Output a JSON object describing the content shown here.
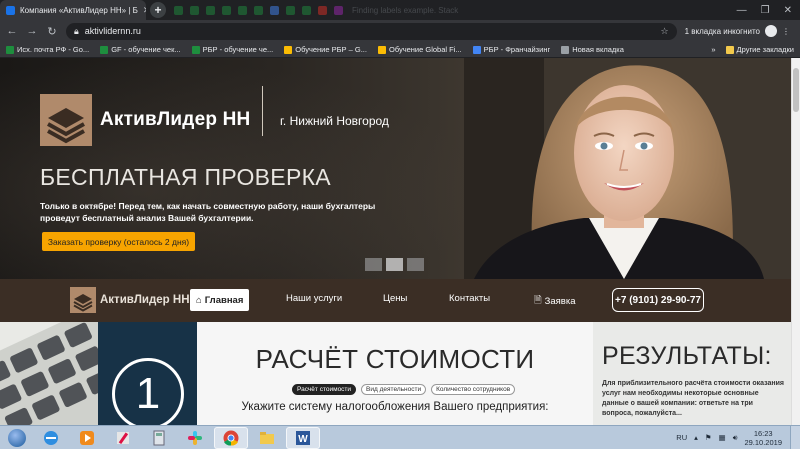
{
  "browser": {
    "active_tab_title": "Компания «АктивЛидер НН» | Б",
    "faded_tab_title": "Finding labels example. Stack",
    "url": "aktivlidernn.ru",
    "incognito_label": "1 вкладка инкогнито",
    "bookmarks": [
      {
        "label": "Исх. почта РФ - Go...",
        "color": "#1e8e3e"
      },
      {
        "label": "GF - обучение чек...",
        "color": "#1e8e3e"
      },
      {
        "label": "РБР - обучение че...",
        "color": "#1e8e3e"
      },
      {
        "label": "Обучение РБР – G...",
        "color": "#fbbc04"
      },
      {
        "label": "Обучение Global Fi...",
        "color": "#fbbc04"
      },
      {
        "label": "РБР - Франчайзинг",
        "color": "#4285f4"
      },
      {
        "label": "Новая вкладка",
        "color": "#9aa0a6"
      }
    ],
    "other_bookmarks": "Другие закладки",
    "more_bookmarks": "»"
  },
  "hero": {
    "logo_text": "АктивЛидер НН",
    "city": "г. Нижний Новгород",
    "title": "БЕСПЛАТНАЯ ПРОВЕРКА",
    "text": "Только в октябре! Перед тем, как начать совместную работу, наши бухгалтеры проведут бесплатный анализ Вашей бухгалтерии.",
    "cta": "Заказать проверку (осталось 2 дня)"
  },
  "nav": {
    "logo_text": "АктивЛидер НН",
    "items": [
      "Главная",
      "Наши услуги",
      "Цены",
      "Контакты",
      "Заявка"
    ],
    "phone": "+7 (9101) 29-90-77"
  },
  "calculator": {
    "step_number": "1",
    "title": "РАСЧЁТ СТОИМОСТИ",
    "steps": [
      "Расчёт стоимости",
      "Вид деятельности",
      "Количество сотрудников"
    ],
    "question": "Укажите систему налогообложения Вашего предприятия:",
    "results_title": "РЕЗУЛЬТАТЫ:",
    "results_text": "Для приблизительного расчёта стоимости оказания услуг нам необходимы некоторые основные данные о вашей компании: ответьте на три вопроса, пожалуйста..."
  },
  "taskbar": {
    "lang": "RU",
    "time": "16:23",
    "date": "29.10.2019"
  }
}
